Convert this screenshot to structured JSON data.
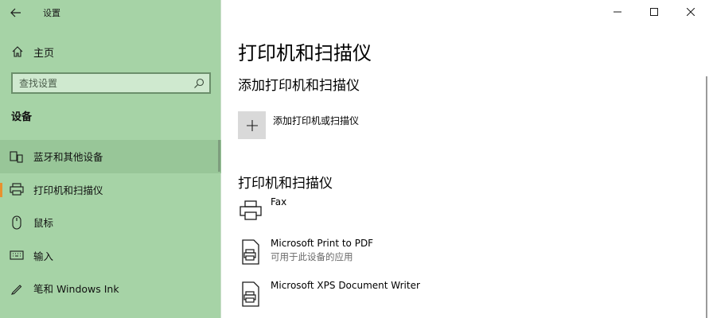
{
  "window": {
    "title": "设置",
    "controls": [
      "minimize",
      "maximize",
      "close"
    ]
  },
  "sidebar": {
    "home_label": "主页",
    "search_placeholder": "查找设置",
    "group_title": "设备",
    "items": [
      {
        "label": "蓝牙和其他设备",
        "icon": "bluetooth-devices-icon",
        "state": "hover"
      },
      {
        "label": "打印机和扫描仪",
        "icon": "printer-icon",
        "state": "selected"
      },
      {
        "label": "鼠标",
        "icon": "mouse-icon",
        "state": "normal"
      },
      {
        "label": "输入",
        "icon": "keyboard-icon",
        "state": "normal"
      },
      {
        "label": "笔和 Windows Ink",
        "icon": "pen-icon",
        "state": "normal"
      }
    ]
  },
  "main": {
    "page_title": "打印机和扫描仪",
    "add_section_title": "添加打印机和扫描仪",
    "add_button_label": "添加打印机或扫描仪",
    "devices_section_title": "打印机和扫描仪",
    "devices": [
      {
        "name": "Fax",
        "subtitle": "",
        "icon": "fax-printer-icon"
      },
      {
        "name": "Microsoft Print to PDF",
        "subtitle": "可用于此设备的应用",
        "icon": "document-printer-icon"
      },
      {
        "name": "Microsoft XPS Document Writer",
        "subtitle": "",
        "icon": "document-printer-icon"
      }
    ]
  },
  "colors": {
    "sidebar_bg": "#a6d3a6",
    "accent_selected": "#e8912f",
    "content_bg": "#ffffff"
  }
}
